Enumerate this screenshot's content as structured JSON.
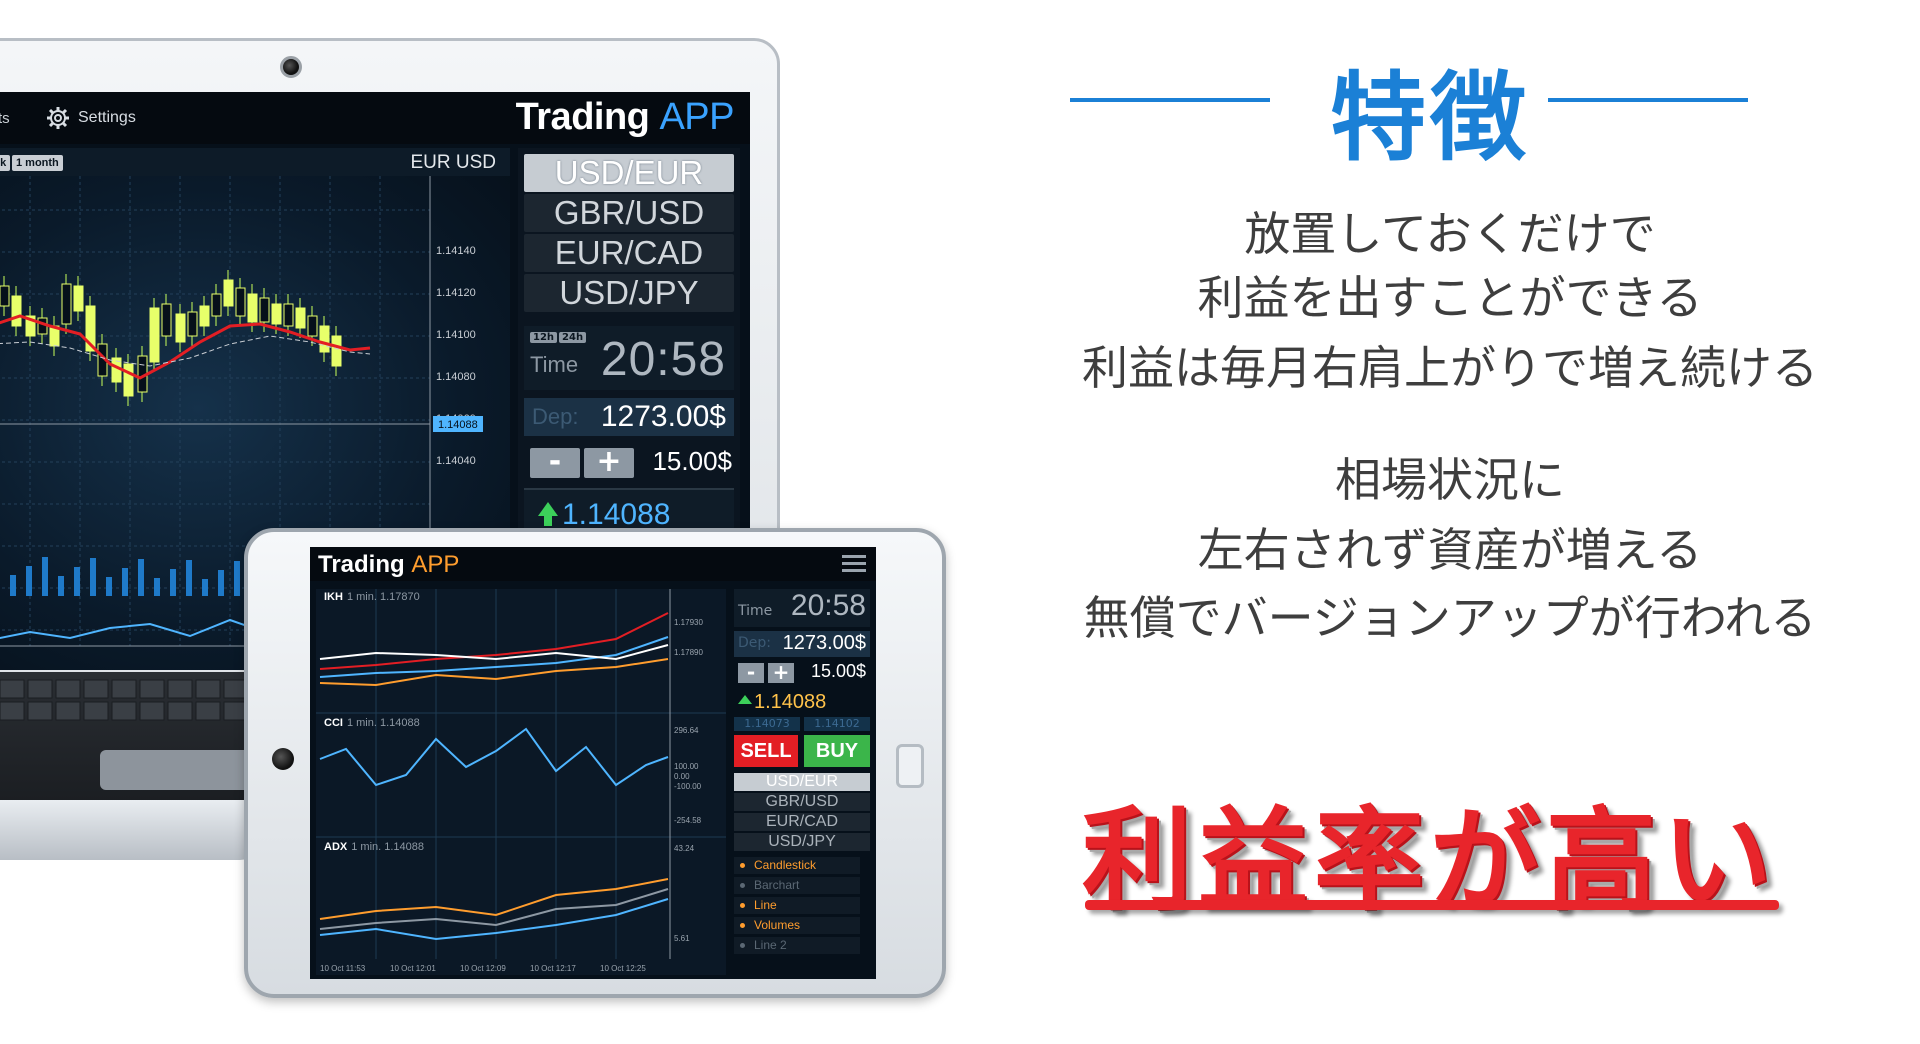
{
  "laptop": {
    "tabs_fragment": "ts",
    "settings_label": "Settings",
    "title_main": "Trading",
    "title_accent": "APP",
    "chip_week": "ek",
    "chip_month": "1 month",
    "pair_label": "EUR USD",
    "y_ticks": [
      "1.14140",
      "1.14120",
      "1.14100",
      "1.14080",
      "1.14060",
      "1.14040"
    ],
    "current_tag": "1.14088",
    "pairs": [
      "USD/EUR",
      "GBR/USD",
      "EUR/CAD",
      "USD/JPY"
    ],
    "time_modes": [
      "12h",
      "24h"
    ],
    "time_label": "Time",
    "time_value": "20:58",
    "dep_label": "Dep:",
    "dep_value": "1273.00$",
    "minus": "-",
    "plus": "+",
    "step_value": "15.00$",
    "price": "1.14088"
  },
  "tablet": {
    "title_main": "Trading",
    "title_accent": "APP",
    "time_label": "Time",
    "time_value": "20:58",
    "dep_label": "Dep:",
    "dep_value": "1273.00$",
    "minus": "-",
    "plus": "+",
    "step_value": "15.00$",
    "price": "1.14088",
    "bid": "1.14073",
    "ask": "1.14102",
    "sell_label": "SELL",
    "buy_label": "BUY",
    "pairs": [
      "USD/EUR",
      "GBR/USD",
      "EUR/CAD",
      "USD/JPY"
    ],
    "chart_types": [
      "Candlestick",
      "Barchart",
      "Line",
      "Volumes",
      "Line 2"
    ],
    "panels": [
      {
        "name": "IKH",
        "sub": "1 min. 1.17870",
        "ticks": [
          "1.17930",
          "1.17890"
        ]
      },
      {
        "name": "CCI",
        "sub": "1 min. 1.14088",
        "ticks": [
          "296.64",
          "100.00",
          "0.00",
          "-100.00",
          "-254.58"
        ]
      },
      {
        "name": "ADX",
        "sub": "1 min. 1.14088",
        "ticks": [
          "43.24",
          "5.61"
        ]
      }
    ],
    "x_ticks": [
      "10 Oct 11:53",
      "10 Oct 12:01",
      "10 Oct 12:09",
      "10 Oct 12:17",
      "10 Oct 12:25"
    ]
  },
  "features": {
    "title": "特徴",
    "block1": [
      "放置しておくだけで",
      "利益を出すことができる",
      "利益は毎月右肩上がりで増え続ける"
    ],
    "block2": [
      "相場状況に",
      "左右されず資産が増える",
      "無償でバージョンアップが行われる"
    ],
    "highlight": "利益率が高い",
    "accent_color": "#1b80d6",
    "highlight_color": "#e8252b"
  }
}
